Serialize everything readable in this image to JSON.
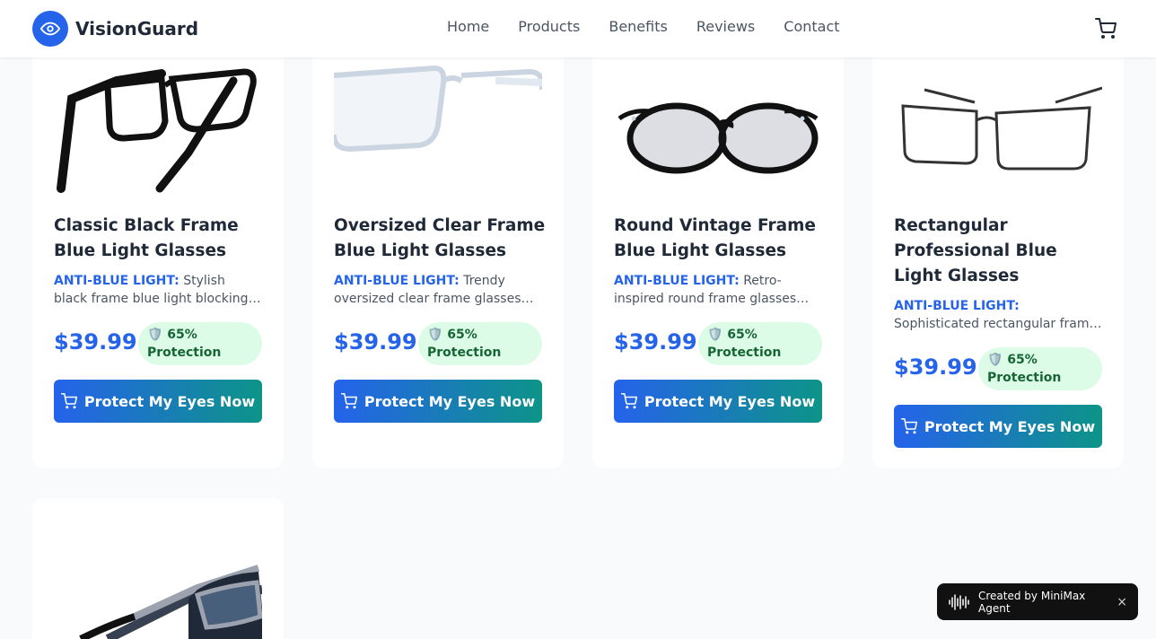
{
  "brand": {
    "name": "VisionGuard",
    "logo_icon": "eye-icon",
    "color": "#2563eb"
  },
  "nav": [
    "Home",
    "Products",
    "Benefits",
    "Reviews",
    "Contact"
  ],
  "cart_icon": "cart-icon",
  "products": [
    {
      "title": "Classic Black Frame Blue Light Glasses",
      "tag": "ANTI-BLUE LIGHT:",
      "desc": "Stylish black frame blue light blocking glasses for everyday use",
      "price": "$39.99",
      "badge": "🛡️ 65% Protection",
      "button": "Protect My Eyes Now"
    },
    {
      "title": "Oversized Clear Frame Blue Light Glasses",
      "tag": "ANTI-BLUE LIGHT:",
      "desc": "Trendy oversized clear frame glasses for screen protection",
      "price": "$39.99",
      "badge": "🛡️ 65% Protection",
      "button": "Protect My Eyes Now"
    },
    {
      "title": "Round Vintage Frame Blue Light Glasses",
      "tag": "ANTI-BLUE LIGHT:",
      "desc": "Retro-inspired round frame glasses with blue light filter",
      "price": "$39.99",
      "badge": "🛡️ 65% Protection",
      "button": "Protect My Eyes Now"
    },
    {
      "title": "Rectangular Professional Blue Light Glasses",
      "tag": "ANTI-BLUE LIGHT:",
      "desc": "Sophisticated rectangular frame for the modern professional",
      "price": "$39.99",
      "badge": "🛡️ 65% Protection",
      "button": "Protect My Eyes Now"
    }
  ],
  "toast": {
    "text": "Created by MiniMax Agent",
    "close": "×",
    "icon": "waveform-icon"
  }
}
